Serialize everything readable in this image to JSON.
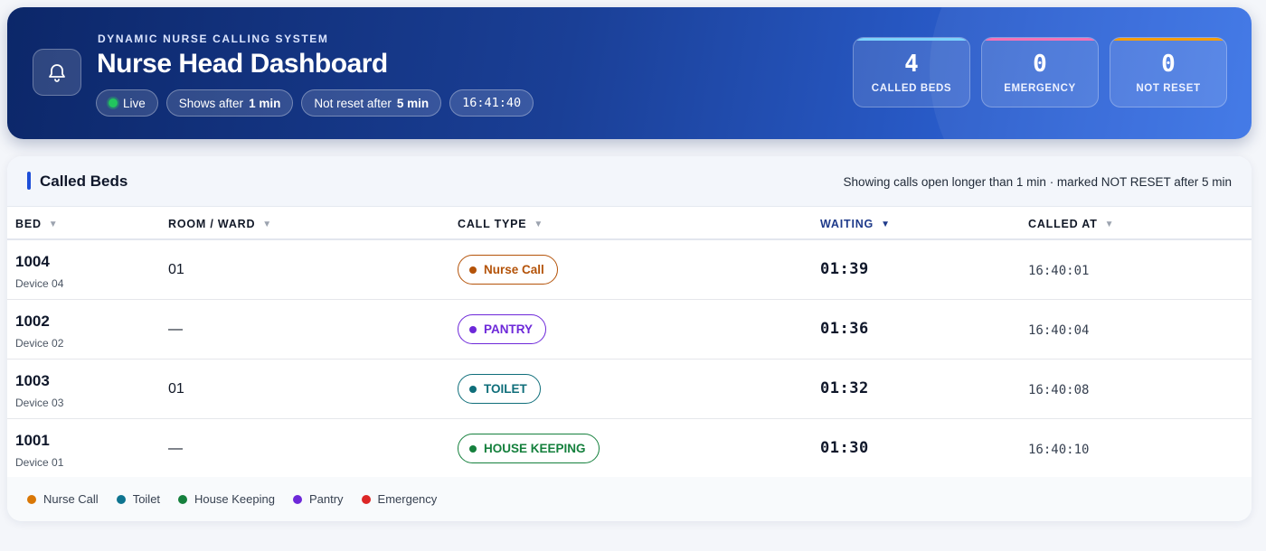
{
  "header": {
    "subtitle": "DYNAMIC NURSE CALLING SYSTEM",
    "title": "Nurse Head Dashboard",
    "live_label": "Live",
    "shows_after_label": "Shows after",
    "shows_after_value": "1 min",
    "not_reset_label": "Not reset after",
    "not_reset_value": "5 min",
    "clock": "16:41:40",
    "icon": "bell-icon"
  },
  "stats": [
    {
      "value": "4",
      "label": "CALLED BEDS",
      "accent": "#7dd3fc"
    },
    {
      "value": "0",
      "label": "EMERGENCY",
      "accent": "#f472b6"
    },
    {
      "value": "0",
      "label": "NOT RESET",
      "accent": "#f59e0b"
    }
  ],
  "card": {
    "title": "Called Beds",
    "note": "Showing calls open longer than 1 min · marked NOT RESET after 5 min"
  },
  "columns": [
    {
      "label": "BED",
      "sort": "▼"
    },
    {
      "label": "ROOM / WARD",
      "sort": "▼"
    },
    {
      "label": "CALL TYPE",
      "sort": "▼"
    },
    {
      "label": "WAITING",
      "sort": "▼",
      "active": true
    },
    {
      "label": "CALLED AT",
      "sort": "▼"
    }
  ],
  "rows": [
    {
      "bed": "1004",
      "device": "Device 04",
      "room": "01",
      "call_type": "Nurse Call",
      "color": "#b45309",
      "waiting": "01:39",
      "called_at": "16:40:01"
    },
    {
      "bed": "1002",
      "device": "Device 02",
      "room": "—",
      "call_type": "PANTRY",
      "color": "#6d28d9",
      "waiting": "01:36",
      "called_at": "16:40:04"
    },
    {
      "bed": "1003",
      "device": "Device 03",
      "room": "01",
      "call_type": "TOILET",
      "color": "#0f6e7a",
      "waiting": "01:32",
      "called_at": "16:40:08"
    },
    {
      "bed": "1001",
      "device": "Device 01",
      "room": "—",
      "call_type": "HOUSE KEEPING",
      "color": "#15803d",
      "waiting": "01:30",
      "called_at": "16:40:10"
    }
  ],
  "legend": [
    {
      "label": "Nurse Call",
      "color": "#d97706"
    },
    {
      "label": "Toilet",
      "color": "#0e7490"
    },
    {
      "label": "House Keeping",
      "color": "#15803d"
    },
    {
      "label": "Pantry",
      "color": "#6d28d9"
    },
    {
      "label": "Emergency",
      "color": "#dc2626"
    }
  ]
}
